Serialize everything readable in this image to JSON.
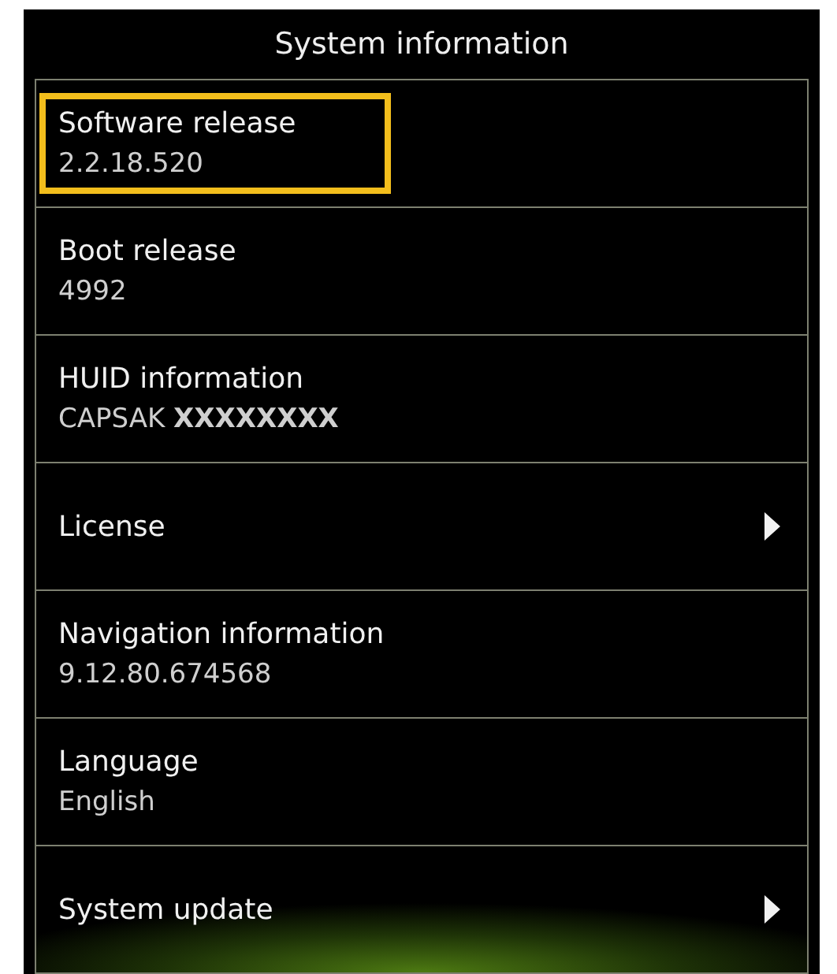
{
  "title": "System information",
  "items": [
    {
      "label": "Software release",
      "value": "2.2.18.520",
      "kind": "info",
      "highlighted": true
    },
    {
      "label": "Boot release",
      "value": "4992",
      "kind": "info",
      "highlighted": false
    },
    {
      "label": "HUID information",
      "value": "CAPSAK **XXXXXXXX**",
      "kind": "info",
      "highlighted": false
    },
    {
      "label": "License",
      "kind": "link",
      "highlighted": false
    },
    {
      "label": "Navigation information",
      "value": "9.12.80.674568",
      "kind": "info",
      "highlighted": false
    },
    {
      "label": "Language",
      "value": "English",
      "kind": "info",
      "highlighted": false
    },
    {
      "label": "System update",
      "kind": "link",
      "highlighted": false
    }
  ]
}
